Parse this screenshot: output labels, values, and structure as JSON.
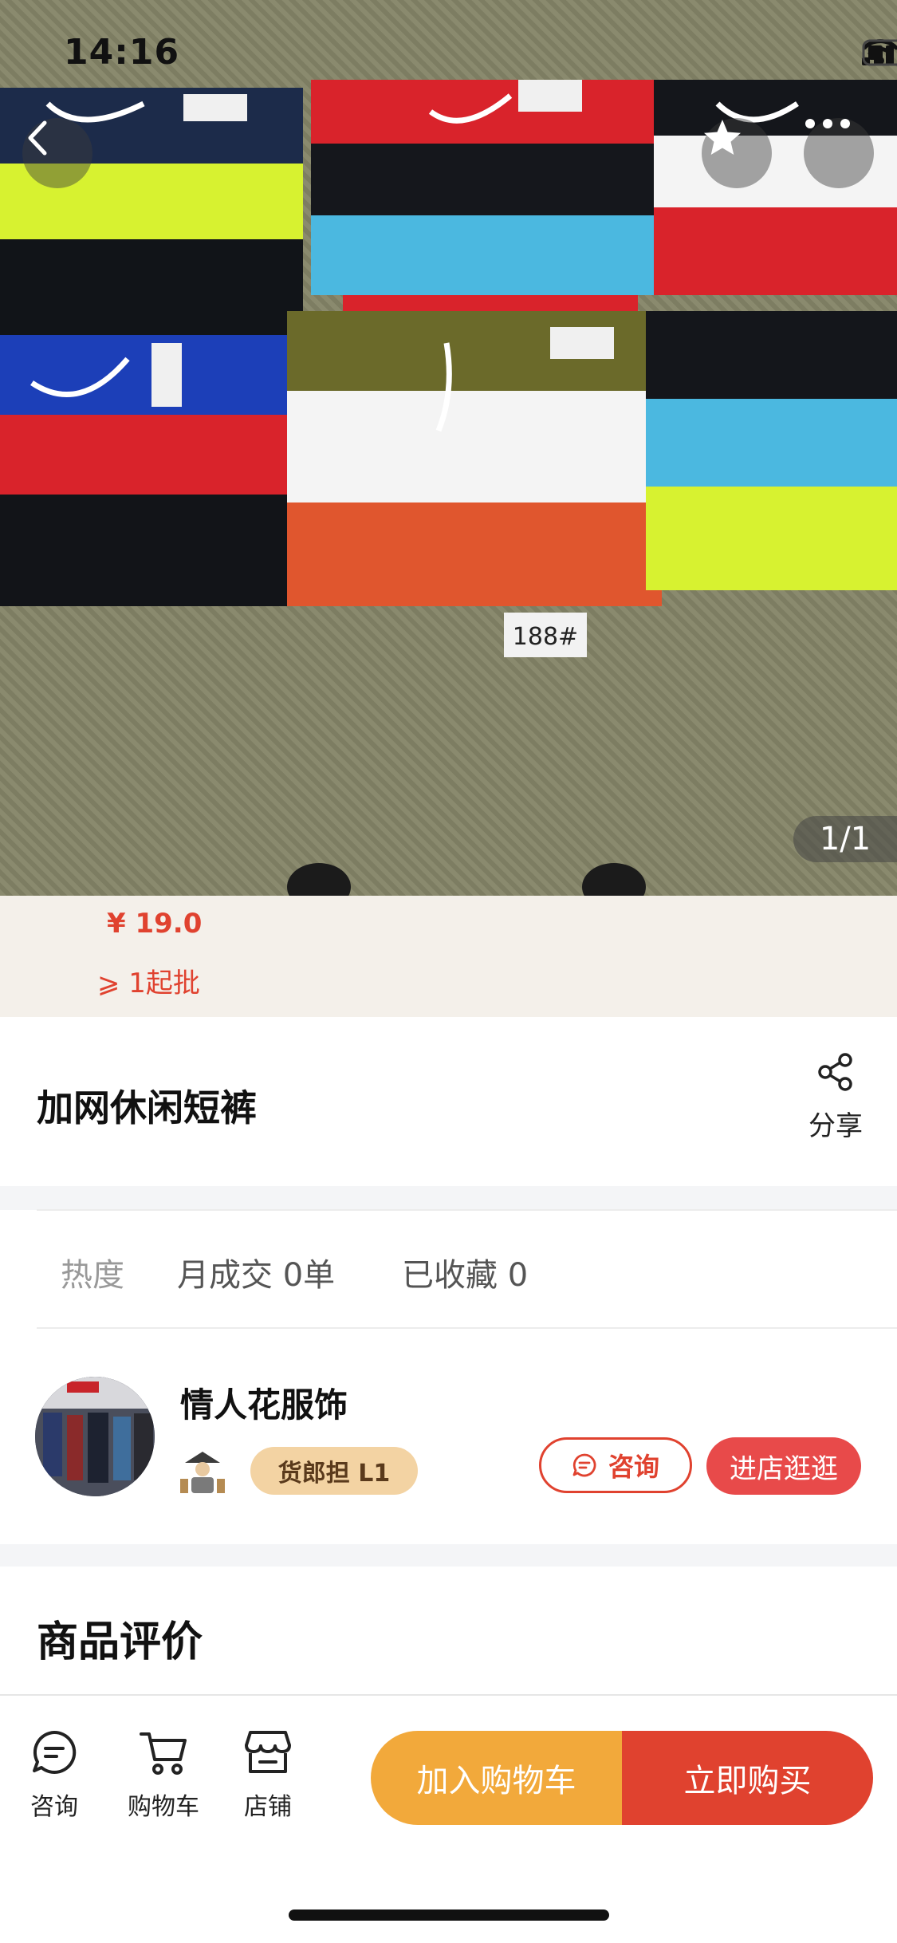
{
  "status_bar": {
    "time": "14:16"
  },
  "gallery": {
    "pager": "1/1",
    "photo_label": "188#"
  },
  "price": {
    "value": "¥ 19.0",
    "moq": "⩾ 1起批"
  },
  "product": {
    "title": "加网休闲短裤",
    "share_label": "分享"
  },
  "stats": {
    "heat": "热度",
    "monthly_sold": "月成交 0单",
    "favorited": "已收藏 0"
  },
  "shop": {
    "name": "情人花服饰",
    "level": "货郎担 L1",
    "consult_label": "咨询",
    "enter_label": "进店逛逛"
  },
  "reviews": {
    "title": "商品评价"
  },
  "bottom_bar": {
    "consult": "咨询",
    "cart": "购物车",
    "shop": "店铺",
    "add_to_cart": "加入购物车",
    "buy_now": "立即购买"
  },
  "colors": {
    "accent_red": "#e0422f",
    "accent_orange": "#f2a93b",
    "badge": "#f3d3a3"
  }
}
